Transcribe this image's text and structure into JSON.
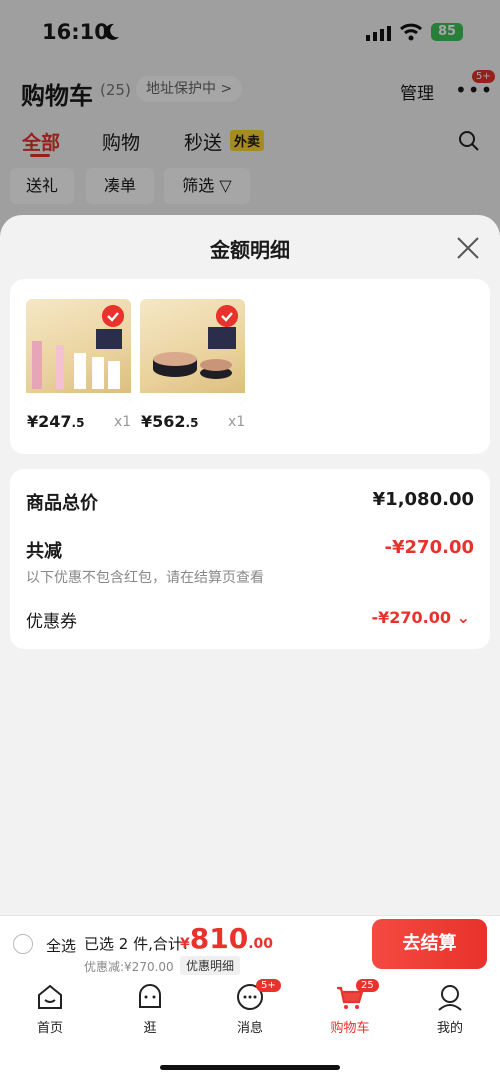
{
  "status_bar": {
    "time": "16:10",
    "battery": "85"
  },
  "cart_header": {
    "title": "购物车",
    "count": "(25)",
    "address_protection": "地址保护中 >",
    "manage": "管理",
    "more_badge": "5+"
  },
  "cart_tabs": [
    {
      "label": "全部"
    },
    {
      "label": "购物"
    },
    {
      "label": "秒送"
    }
  ],
  "waimai_badge": "外卖",
  "filters": [
    {
      "label": "送礼"
    },
    {
      "label": "凑单"
    },
    {
      "label": "筛选 ▽"
    }
  ],
  "sheet": {
    "title": "金额明细",
    "products": [
      {
        "price_int": "¥247",
        "price_dec": ".5",
        "qty": "x1"
      },
      {
        "price_int": "¥562",
        "price_dec": ".5",
        "qty": "x1"
      }
    ],
    "summary": {
      "total_label": "商品总价",
      "total_value": "¥1,080.00",
      "reduce_label": "共减",
      "reduce_value": "-¥270.00",
      "hint": "以下优惠不包含红包，请在结算页查看",
      "coupon_label": "优惠券",
      "coupon_value": "-¥270.00 ⌄"
    }
  },
  "checkout": {
    "select_all": "全选",
    "selected": "已选 2 件,合计:",
    "total_yen": "¥",
    "total_int": "810",
    "total_dec": ".00",
    "discount": "优惠减:¥270.00",
    "detail_chip": "优惠明细",
    "button": "去结算"
  },
  "tabbar": [
    {
      "label": "首页"
    },
    {
      "label": "逛"
    },
    {
      "label": "消息",
      "badge": "5+"
    },
    {
      "label": "购物车",
      "badge": "25"
    },
    {
      "label": "我的"
    }
  ],
  "colors": {
    "accent": "#e8322b"
  }
}
